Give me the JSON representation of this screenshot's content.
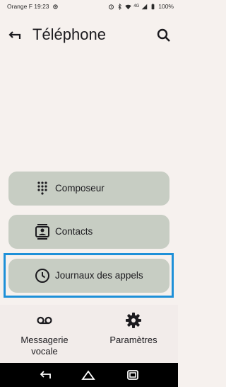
{
  "status_bar": {
    "carrier_time": "Orange F 19:23",
    "network": "4G",
    "battery": "100%",
    "icons": [
      "settings-gear-icon",
      "alarm-icon",
      "bluetooth-icon",
      "wifi-icon",
      "signal-icon",
      "battery-icon"
    ]
  },
  "header": {
    "title": "Téléphone",
    "back_icon": "back-arrow-icon",
    "search_icon": "search-icon"
  },
  "actions": [
    {
      "label": "Composeur",
      "icon": "dialpad-icon"
    },
    {
      "label": "Contacts",
      "icon": "contacts-icon"
    },
    {
      "label": "Journaux des appels",
      "icon": "clock-icon"
    }
  ],
  "bottom_bar": {
    "voicemail_label": "Messagerie\nvocale",
    "voicemail_icon": "voicemail-icon",
    "settings_label": "Paramètres",
    "settings_icon": "gear-icon"
  },
  "nav_bar": {
    "icons": [
      "nav-back-icon",
      "nav-home-icon",
      "nav-recents-icon"
    ]
  },
  "colors": {
    "background": "#f6f1ee",
    "pill": "#c7cdc3",
    "highlight": "#1e90d8",
    "navbar": "#000000"
  }
}
